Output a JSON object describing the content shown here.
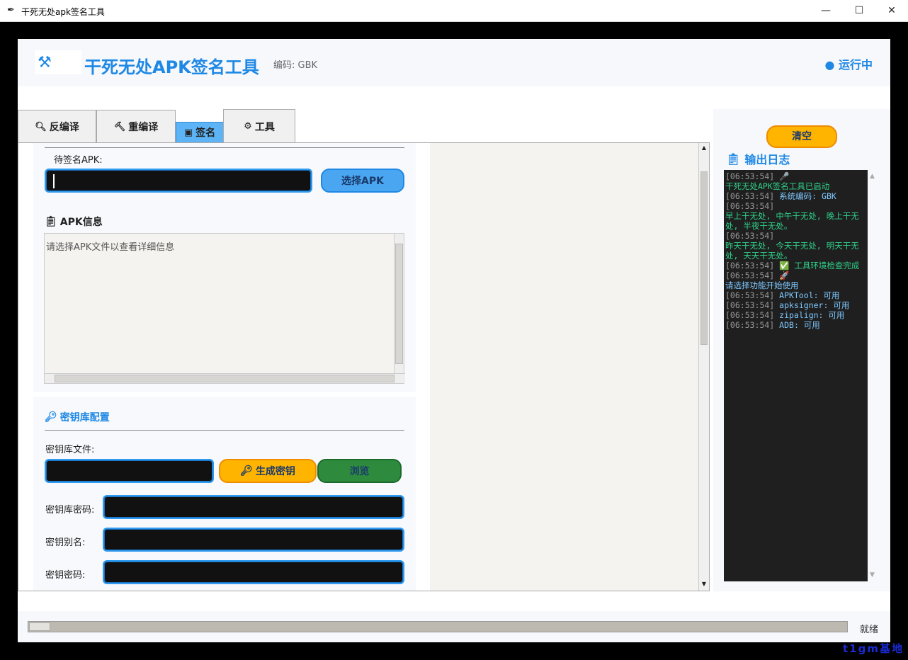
{
  "window": {
    "title": "干死无处apk签名工具",
    "icon": "feather-icon",
    "controls": [
      "—",
      "☐",
      "✕"
    ]
  },
  "header": {
    "logo_icon": "tools-icon",
    "app_title": "干死无处APK签名工具",
    "encoding": "编码: GBK",
    "status": "● 运行中"
  },
  "tabs": [
    {
      "label": "反编译",
      "icon": "search-icon"
    },
    {
      "label": "重编译",
      "icon": "hammer-icon"
    },
    {
      "label": "签名",
      "icon": "stamp-icon",
      "active": true
    },
    {
      "label": "工具",
      "icon": "gear-icon"
    }
  ],
  "sign": {
    "apk_label": "待签名APK:",
    "apk_value": "",
    "select_apk_button": "选择APK",
    "info_title": "APK信息",
    "info_placeholder": "请选择APK文件以查看详细信息",
    "keystore_title": "密钥库配置",
    "keystore_file_label": "密钥库文件:",
    "keystore_file_value": "",
    "generate_key_button": "生成密钥",
    "browse_button": "浏览",
    "keystore_password_label": "密钥库密码:",
    "key_alias_label": "密钥别名:",
    "key_password_label": "密钥密码:"
  },
  "log": {
    "clear_button": "清空",
    "title": "输出日志",
    "lines": [
      {
        "ts": "[06:53:54]",
        "msg": " 🎤",
        "color": "green"
      },
      {
        "ts": "",
        "msg": "干死无处APK签名工具已启动",
        "color": "green"
      },
      {
        "ts": "[06:53:54]",
        "msg": " 系统编码: GBK",
        "color": "blue"
      },
      {
        "ts": "[06:53:54]",
        "msg": "",
        "color": "green"
      },
      {
        "ts": "",
        "msg": "早上干无处, 中午干无处, 晚上干无处, 半夜干无处。",
        "color": "green"
      },
      {
        "ts": "[06:53:54]",
        "msg": "",
        "color": "green"
      },
      {
        "ts": "",
        "msg": "昨天干无处, 今天干无处, 明天干无处, 天天干无处。",
        "color": "green"
      },
      {
        "ts": "[06:53:54]",
        "msg": " ✅ 工具环境检查完成",
        "color": "green"
      },
      {
        "ts": "[06:53:54]",
        "msg": " 🚀",
        "color": "blue"
      },
      {
        "ts": "",
        "msg": "请选择功能开始使用",
        "color": "blue"
      },
      {
        "ts": "[06:53:54]",
        "msg": " APKTool: 可用",
        "color": "blue"
      },
      {
        "ts": "[06:53:54]",
        "msg": " apksigner: 可用",
        "color": "blue"
      },
      {
        "ts": "[06:53:54]",
        "msg": " zipalign: 可用",
        "color": "blue"
      },
      {
        "ts": "[06:53:54]",
        "msg": " ADB: 可用",
        "color": "blue"
      }
    ]
  },
  "statusbar": {
    "progress": 0,
    "status_text": "就绪"
  },
  "watermark": "t1gm基地"
}
